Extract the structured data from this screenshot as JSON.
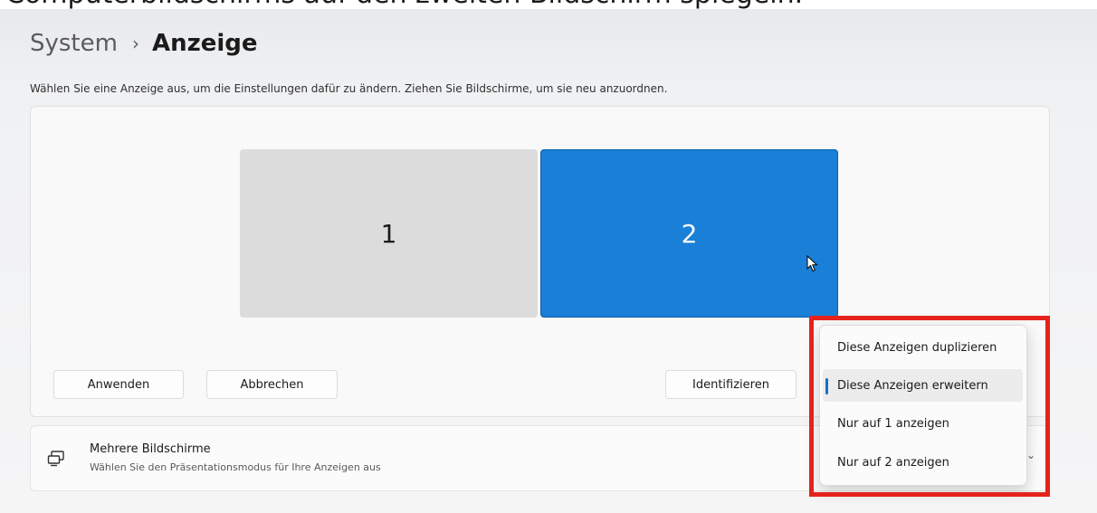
{
  "caption": {
    "text": "Computerbildschirms auf den zweiten Bildschirm spiegeln."
  },
  "breadcrumb": {
    "parent": "System",
    "separator": "›",
    "current": "Anzeige"
  },
  "instruction": "Wählen Sie eine Anzeige aus, um die Einstellungen dafür zu ändern. Ziehen Sie Bildschirme, um sie neu anzuordnen.",
  "monitors": [
    {
      "label": "1",
      "selected": false
    },
    {
      "label": "2",
      "selected": true
    }
  ],
  "buttons": {
    "apply": "Anwenden",
    "cancel": "Abbrechen",
    "identify": "Identifizieren"
  },
  "multiple_displays": {
    "icon": "multi-monitor-icon",
    "title": "Mehrere Bildschirme",
    "subtitle": "Wählen Sie den Präsentationsmodus für Ihre Anzeigen aus",
    "chevron": "chevron-down-icon"
  },
  "projection_menu": {
    "items": [
      "Diese Anzeigen duplizieren",
      "Diese Anzeigen erweitern",
      "Nur auf 1 anzeigen",
      "Nur auf 2 anzeigen"
    ],
    "selected_index": 1
  },
  "colors": {
    "accent": "#1a7fd6",
    "highlight": "#e5231b",
    "selection_bar": "#1a6fc4"
  }
}
